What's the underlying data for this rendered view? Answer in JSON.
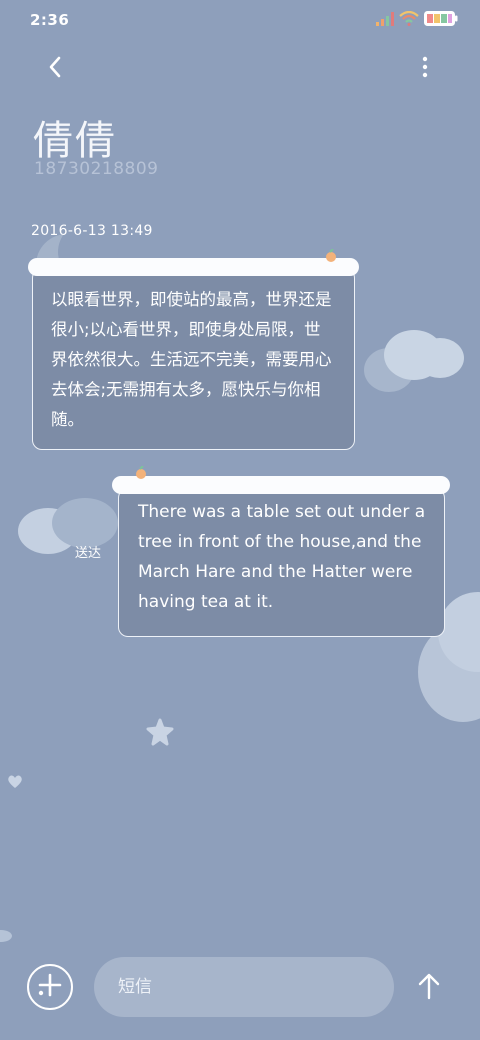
{
  "status_bar": {
    "time": "2:36"
  },
  "header": {
    "contact_name": "倩倩",
    "contact_number": "18730218809"
  },
  "conversation": {
    "timestamp": "2016-6-13 13:49",
    "messages": [
      {
        "direction": "incoming",
        "text": "以眼看世界，即使站的最高，世界还是很小;以心看世界，即使身处局限，世界依然很大。生活远不完美，需要用心去体会;无需拥有太多，愿快乐与你相随。"
      },
      {
        "direction": "outgoing",
        "text": "There was a table set out under a tree in front of the house,and the March Hare and the Hatter were having tea at it.",
        "status": "送达"
      }
    ]
  },
  "composer": {
    "placeholder": "短信"
  },
  "icons": [
    "back-arrow-icon",
    "more-vertical-icon",
    "add-icon",
    "send-arrow-icon",
    "signal-icon",
    "wifi-icon",
    "battery-icon"
  ],
  "colors": {
    "background": "#8e9fbb",
    "bubble_border": "#eef2f8",
    "input_bg": "#a7b5cb"
  }
}
